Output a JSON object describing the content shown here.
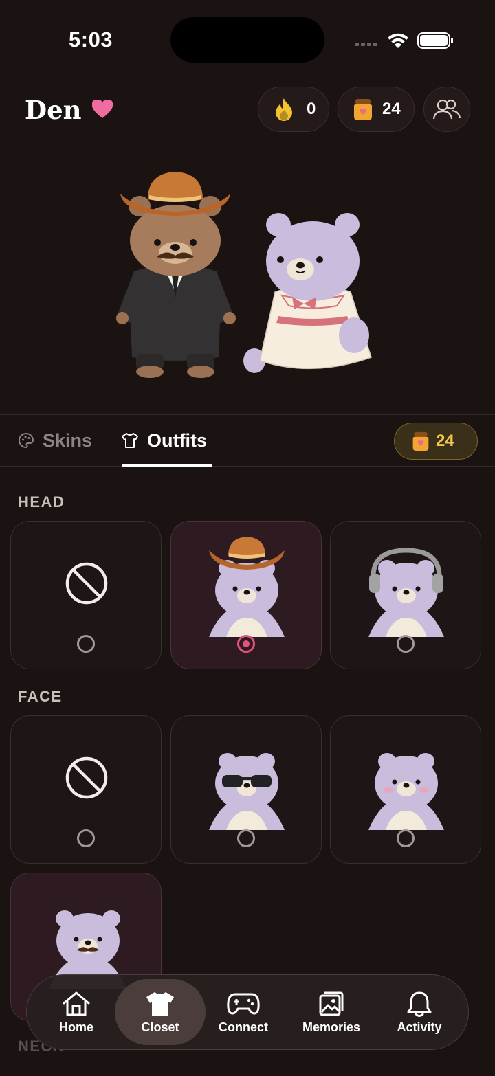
{
  "status_bar": {
    "time": "5:03"
  },
  "header": {
    "title": "Den",
    "streak_count": "0",
    "honey_count": "24"
  },
  "tabs": [
    {
      "label": "Skins",
      "icon": "palette-icon",
      "active": false
    },
    {
      "label": "Outfits",
      "icon": "shirt-icon",
      "active": true
    }
  ],
  "balance": "24",
  "sections": {
    "head": {
      "label": "HEAD",
      "items": [
        {
          "name": "none",
          "selected": false
        },
        {
          "name": "cowboy-hat",
          "selected": true
        },
        {
          "name": "headphones",
          "selected": false
        }
      ]
    },
    "face": {
      "label": "FACE",
      "items": [
        {
          "name": "none",
          "selected": false
        },
        {
          "name": "sunglasses",
          "selected": false
        },
        {
          "name": "blush",
          "selected": false
        },
        {
          "name": "mustache",
          "selected": true
        }
      ]
    },
    "neck": {
      "label": "NECK"
    }
  },
  "nav": [
    {
      "label": "Home",
      "icon": "home-icon"
    },
    {
      "label": "Closet",
      "icon": "shirt-icon",
      "active": true
    },
    {
      "label": "Connect",
      "icon": "gamepad-icon"
    },
    {
      "label": "Memories",
      "icon": "photos-icon"
    },
    {
      "label": "Activity",
      "icon": "bell-icon"
    }
  ],
  "colors": {
    "background": "#1b1212",
    "accent_pink": "#e2537b",
    "gold": "#f2c94c",
    "bear_lavender": "#c9bcdc"
  }
}
